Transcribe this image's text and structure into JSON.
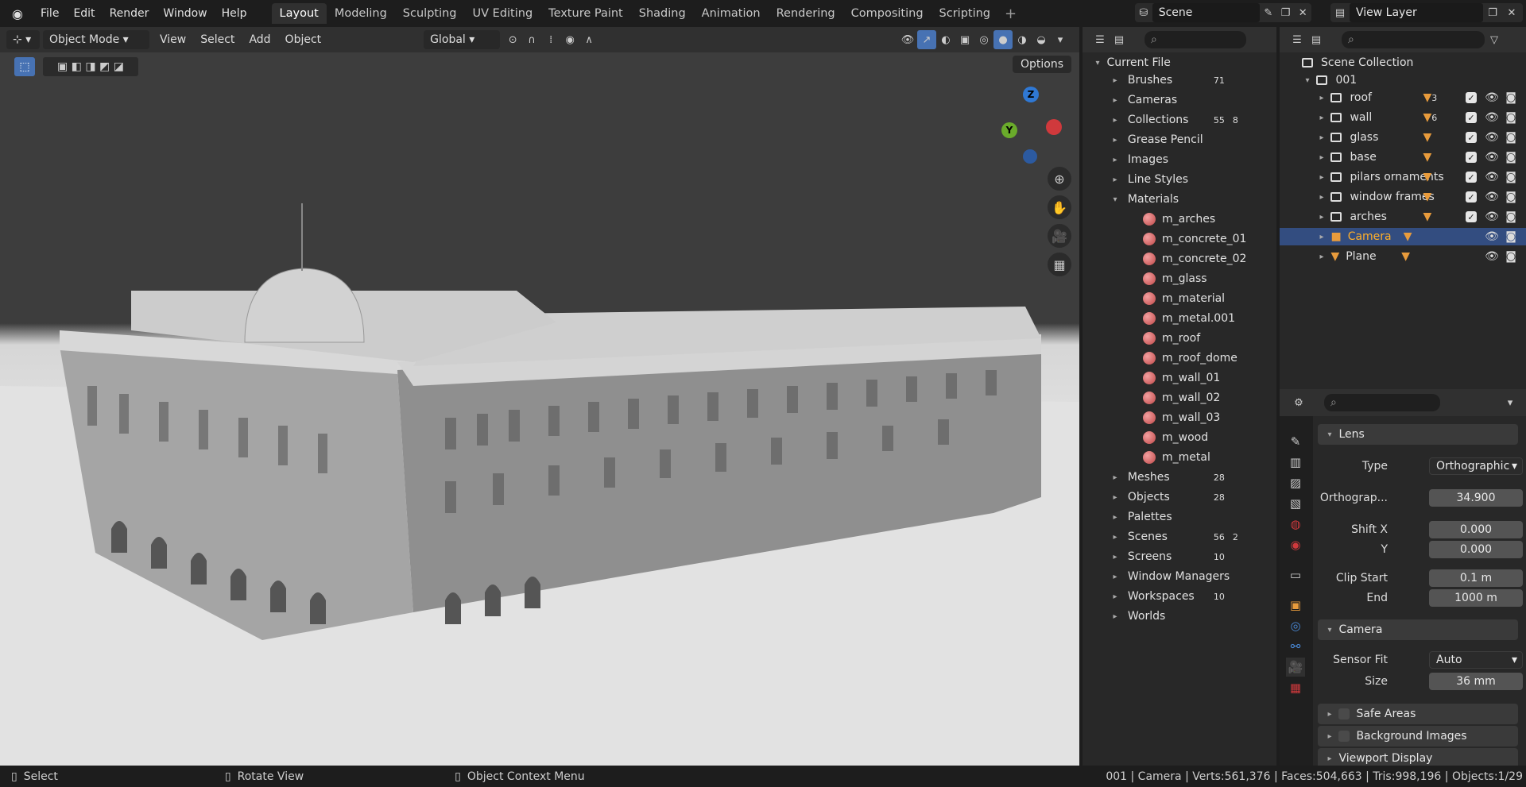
{
  "menu": [
    "File",
    "Edit",
    "Render",
    "Window",
    "Help"
  ],
  "workspaces": [
    "Layout",
    "Modeling",
    "Sculpting",
    "UV Editing",
    "Texture Paint",
    "Shading",
    "Animation",
    "Rendering",
    "Compositing",
    "Scripting"
  ],
  "active_workspace": "Layout",
  "scene_name": "Scene",
  "view_layer": "View Layer",
  "viewport_header": {
    "mode": "Object Mode",
    "view": "View",
    "select": "Select",
    "add": "Add",
    "object": "Object",
    "orientation": "Global",
    "options": "Options"
  },
  "gizmo": {
    "z": "Z",
    "y": "Y"
  },
  "outliner_left": {
    "root": "Current File",
    "items": [
      {
        "label": "Brushes",
        "count": "71"
      },
      {
        "label": "Cameras",
        "count": ""
      },
      {
        "label": "Collections",
        "count": "55",
        "count2": "8"
      },
      {
        "label": "Grease Pencil",
        "count": ""
      },
      {
        "label": "Images",
        "count": ""
      },
      {
        "label": "Line Styles",
        "count": ""
      },
      {
        "label": "Materials",
        "count": ""
      }
    ],
    "materials": [
      "m_arches",
      "m_concrete_01",
      "m_concrete_02",
      "m_glass",
      "m_material",
      "m_metal.001",
      "m_roof",
      "m_roof_dome",
      "m_wall_01",
      "m_wall_02",
      "m_wall_03",
      "m_wood",
      "m_metal"
    ],
    "items2": [
      {
        "label": "Meshes",
        "count": "28"
      },
      {
        "label": "Objects",
        "count": "28"
      },
      {
        "label": "Palettes",
        "count": ""
      },
      {
        "label": "Scenes",
        "count": "56",
        "count2": "2"
      },
      {
        "label": "Screens",
        "count": "10"
      },
      {
        "label": "Window Managers",
        "count": ""
      },
      {
        "label": "Workspaces",
        "count": "10"
      },
      {
        "label": "Worlds",
        "count": ""
      }
    ]
  },
  "outliner_right": {
    "root": "Scene Collection",
    "collection": "001",
    "items": [
      {
        "label": "roof",
        "count": "3"
      },
      {
        "label": "wall",
        "count": "6"
      },
      {
        "label": "glass",
        "count": ""
      },
      {
        "label": "base",
        "count": ""
      },
      {
        "label": "pilars ornaments",
        "count": ""
      },
      {
        "label": "window frames",
        "count": ""
      },
      {
        "label": "arches",
        "count": ""
      },
      {
        "label": "Camera",
        "count": ""
      },
      {
        "label": "Plane",
        "count": ""
      }
    ]
  },
  "properties": {
    "lens_title": "Lens",
    "type_label": "Type",
    "type_value": "Orthographic",
    "ortho_label": "Orthograp...",
    "ortho_value": "34.900",
    "shiftx_label": "Shift X",
    "shiftx_value": "0.000",
    "y_label": "Y",
    "y_value": "0.000",
    "clipstart_label": "Clip Start",
    "clipstart_value": "0.1 m",
    "end_label": "End",
    "end_value": "1000 m",
    "camera_title": "Camera",
    "sensorfit_label": "Sensor Fit",
    "sensorfit_value": "Auto",
    "size_label": "Size",
    "size_value": "36 mm",
    "safe_areas": "Safe Areas",
    "background_images": "Background Images",
    "viewport_display": "Viewport Display"
  },
  "status": {
    "select": "Select",
    "rotate": "Rotate View",
    "context": "Object Context Menu",
    "stats": "001 | Camera | Verts:561,376 | Faces:504,663 | Tris:998,196 | Objects:1/29"
  }
}
